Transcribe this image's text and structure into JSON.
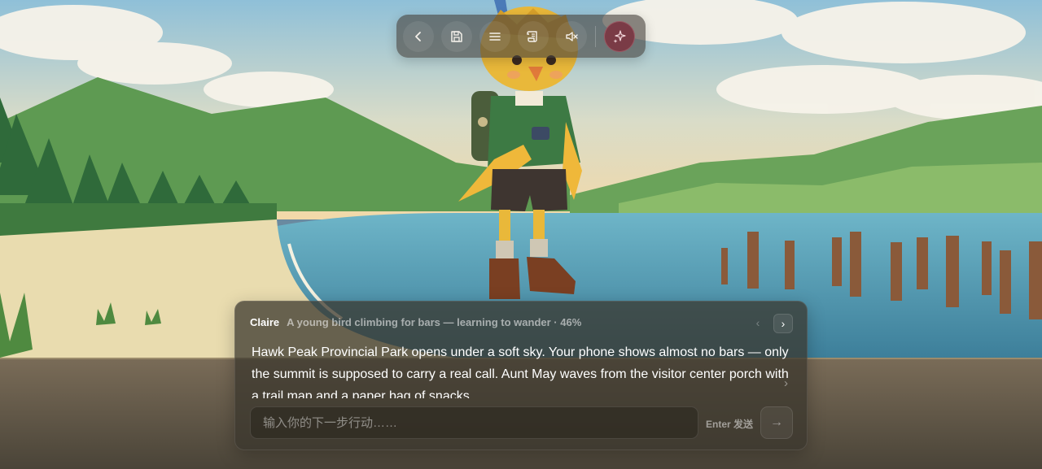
{
  "toolbar": {
    "buttons": [
      {
        "icon": "chevron-left-icon"
      },
      {
        "icon": "save-icon"
      },
      {
        "icon": "menu-icon"
      },
      {
        "icon": "scroll-icon"
      },
      {
        "icon": "mute-icon"
      },
      {
        "icon": "sparkle-icon"
      }
    ],
    "accent_color": "#7a3b46"
  },
  "dialogue": {
    "speaker": "Claire",
    "subtitle": "A young bird climbing for bars — learning to wander · 46%",
    "progress_percent": 46,
    "story_text": "Hawk Peak Provincial Park opens under a soft sky. Your phone shows almost no bars — only the summit is supposed to carry a real call. Aunt May waves from the visitor center porch with a trail map and a paper bag of snacks.",
    "prev_label": "‹",
    "next_label": "›",
    "more_label": "›"
  },
  "input": {
    "placeholder": "输入你的下一步行动……",
    "value": "",
    "enter_hint": "Enter 发送",
    "send_label": "→"
  }
}
